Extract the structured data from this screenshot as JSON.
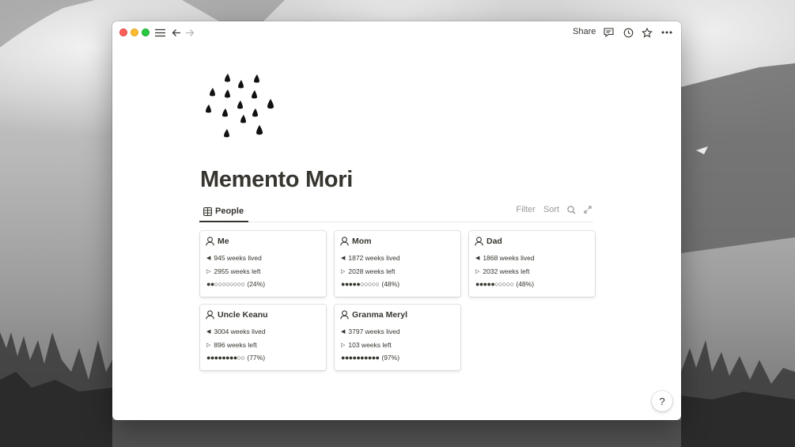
{
  "toolbar": {
    "share_label": "Share",
    "icons": [
      "menu-icon",
      "back-arrow-icon",
      "forward-arrow-icon",
      "comment-icon",
      "history-icon",
      "star-icon",
      "more-icon"
    ]
  },
  "page": {
    "title": "Memento Mori",
    "icon": "rain-drops-icon"
  },
  "database": {
    "view_tab_label": "People",
    "view_icon": "gallery-icon",
    "filter_label": "Filter",
    "sort_label": "Sort",
    "cards": [
      {
        "name": "Me",
        "lived": "945 weeks lived",
        "left": "2955 weeks left",
        "progress_dots": "●●○○○○○○○○",
        "progress_pct": "(24%)"
      },
      {
        "name": "Mom",
        "lived": "1872 weeks lived",
        "left": "2028 weeks left",
        "progress_dots": "●●●●●○○○○○",
        "progress_pct": "(48%)"
      },
      {
        "name": "Dad",
        "lived": "1868 weeks lived",
        "left": "2032 weeks left",
        "progress_dots": "●●●●●○○○○○",
        "progress_pct": "(48%)"
      },
      {
        "name": "Uncle Keanu",
        "lived": "3004 weeks lived",
        "left": "896 weeks left",
        "progress_dots": "●●●●●●●●○○",
        "progress_pct": "(77%)"
      },
      {
        "name": "Granma Meryl",
        "lived": "3797 weeks lived",
        "left": "103 weeks left",
        "progress_dots": "●●●●●●●●●●",
        "progress_pct": "(97%)"
      }
    ]
  },
  "help": {
    "label": "?"
  },
  "colors": {
    "text": "#37352f",
    "muted": "#9b9a97",
    "close": "#fe5f57",
    "minimize": "#febc2e",
    "zoom": "#28c840"
  }
}
